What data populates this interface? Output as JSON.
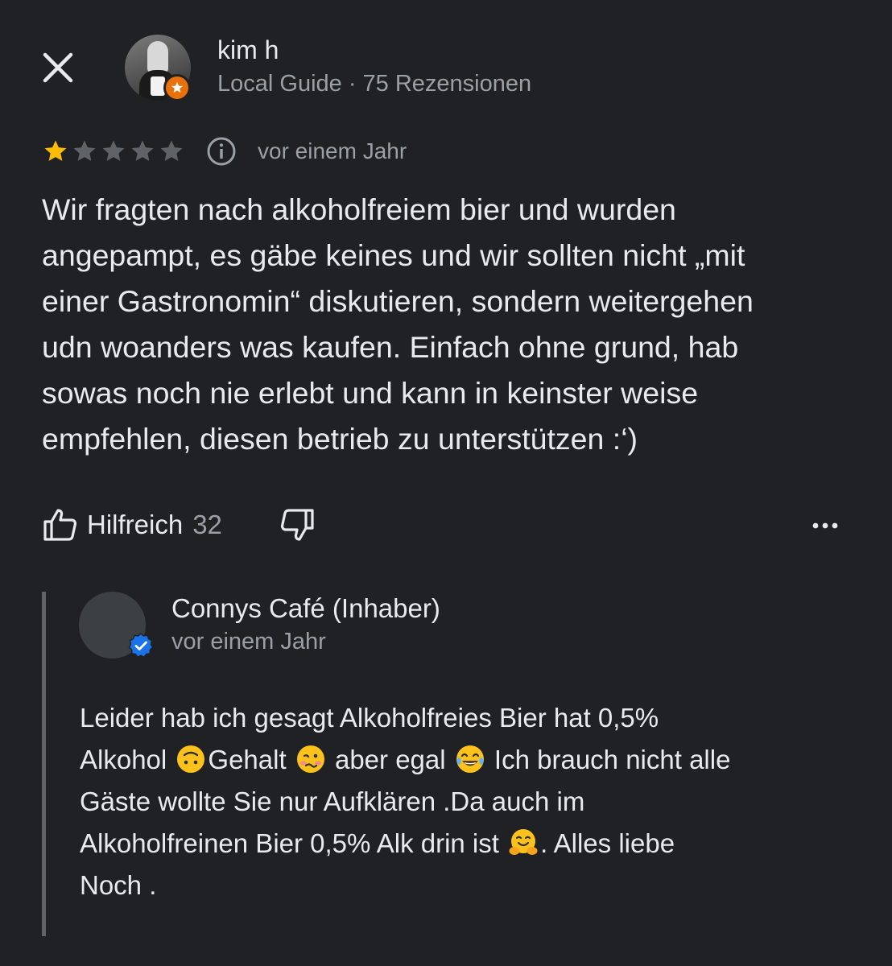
{
  "reviewer": {
    "name": "kim h",
    "meta": "Local Guide · 75 Rezensionen"
  },
  "review": {
    "rating": 1,
    "max_rating": 5,
    "time": "vor einem Jahr",
    "text_lines": [
      "Wir fragten nach alkoholfreiem bier und wurden",
      "angepampt, es gäbe keines und wir sollten nicht „mit",
      "einer Gastronomin“ diskutieren, sondern weitergehen",
      "udn woanders was kaufen. Einfach ohne grund, hab",
      "sowas noch nie erlebt und kann in keinster weise",
      "empfehlen, diesen betrieb zu unterstützen :‘)"
    ]
  },
  "actions": {
    "helpful_label": "Hilfreich",
    "helpful_count": "32"
  },
  "owner_reply": {
    "name": "Connys Café (Inhaber)",
    "time": "vor einem Jahr",
    "line1": "Leider hab ich gesagt Alkoholfreies Bier hat  0,5%",
    "line2_a": "Alkohol ",
    "line2_b": "Gehalt ",
    "line2_c": " aber egal ",
    "line2_d": "  Ich brauch nicht alle",
    "line3": "Gäste wollte Sie nur Aufklären .Da auch im",
    "line4_a": "Alkoholfreinen Bier 0,5% Alk drin ist ",
    "line4_b": ". Alles liebe",
    "line5": "Noch ."
  },
  "colors": {
    "background": "#202124",
    "text": "#e8eaed",
    "secondary": "#9aa0a6",
    "star_filled": "#fbbc04",
    "star_empty": "#5f6368",
    "guide_badge": "#e8710a",
    "verified": "#1a73e8"
  },
  "icons": [
    "close-icon",
    "local-guide-badge-icon",
    "star-icon",
    "info-icon",
    "thumbs-up-icon",
    "thumbs-down-icon",
    "more-options-icon",
    "verified-badge-icon",
    "upside-down-face-emoji",
    "woozy-face-emoji",
    "tears-of-joy-emoji",
    "hugging-face-emoji"
  ]
}
